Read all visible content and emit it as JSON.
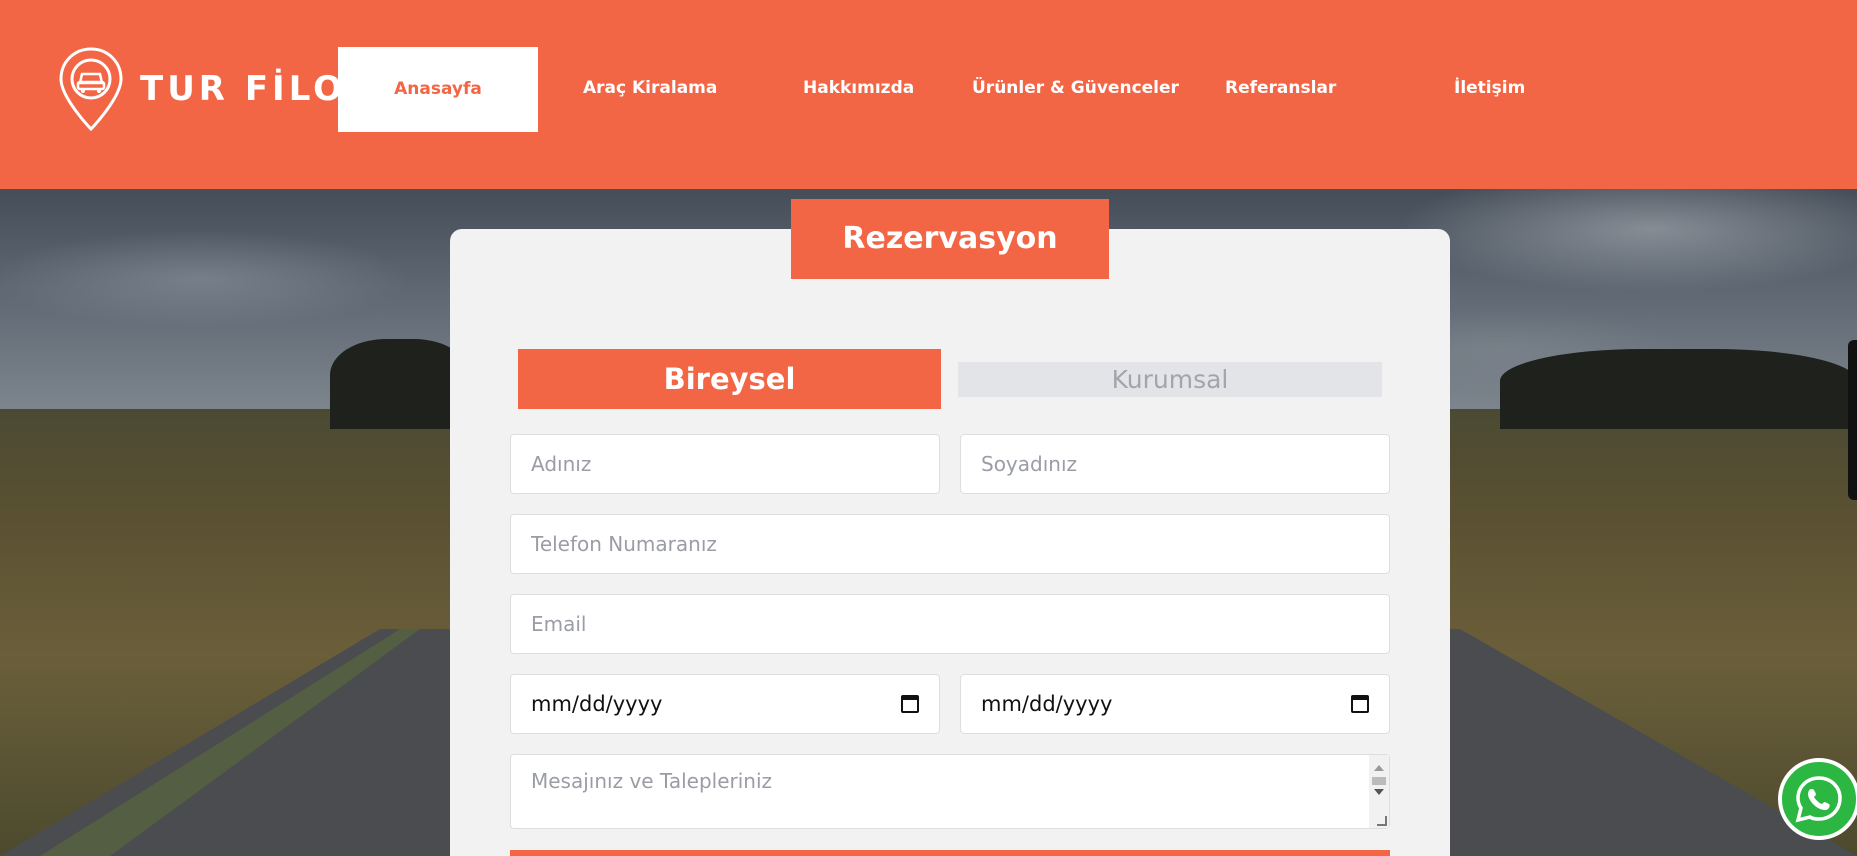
{
  "brand": {
    "name": "TUR FİLO",
    "accent": "#f26646"
  },
  "nav": {
    "items": [
      {
        "label": "Anasayfa",
        "active": true
      },
      {
        "label": "Araç Kiralama"
      },
      {
        "label": "Hakkımızda"
      },
      {
        "label": "Ürünler & Güvenceler"
      },
      {
        "label": "Referanslar"
      },
      {
        "label": "İletişim"
      }
    ]
  },
  "form": {
    "title": "Rezervasyon",
    "tabs": [
      {
        "label": "Bireysel",
        "selected": true
      },
      {
        "label": "Kurumsal",
        "selected": false
      }
    ],
    "first_name_placeholder": "Adınız",
    "last_name_placeholder": "Soyadınız",
    "phone_placeholder": "Telefon Numaranız",
    "email_placeholder": "Email",
    "start_date_value": "mm/dd/yyyy",
    "end_date_value": "mm/dd/yyyy",
    "message_placeholder": "Mesajınız ve Talepleriniz"
  },
  "icons": {
    "logo": "location-pin-car-icon",
    "calendar": "calendar-icon",
    "whatsapp": "whatsapp-icon"
  }
}
